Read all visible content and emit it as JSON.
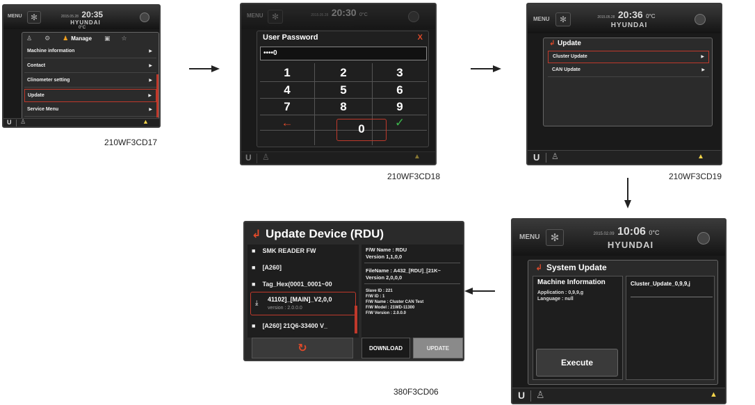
{
  "common": {
    "menu": "MENU",
    "brand": "HYUNDAI",
    "unit_label": "U"
  },
  "s1": {
    "date": "2015.05.28",
    "time": "20:35",
    "temp": "0°C",
    "manage": "Manage",
    "items": [
      "Machine information",
      "Contact",
      "Clinometer setting",
      "Update",
      "Service Menu"
    ],
    "caption": "210WF3CD17"
  },
  "s2": {
    "date": "2015.05.28",
    "time": "20:30",
    "temp": "0°C",
    "title": "User Password",
    "close": "X",
    "value": "••••0",
    "keys": [
      "1",
      "2",
      "3",
      "4",
      "5",
      "6",
      "7",
      "8",
      "9"
    ],
    "zero": "0",
    "back": "←",
    "ok": "✓",
    "caption": "210WF3CD18"
  },
  "s3": {
    "date": "2015.05.28",
    "time": "20:36",
    "temp": "0°C",
    "title": "Update",
    "items": [
      "Cluster Update",
      "CAN Update"
    ],
    "caption": "210WF3CD19"
  },
  "s4": {
    "date": "2015.02.09",
    "time": "10:06",
    "temp": "0°C",
    "title": "System Update",
    "machine_info": "Machine Information",
    "application": "Application : 0,9,9,g",
    "language": "Language : null",
    "file": "Cluster_Update_0,9,9,j",
    "execute": "Execute"
  },
  "s5": {
    "title": "Update Device (RDU)",
    "list": [
      "SMK READER FW",
      "[A260]",
      "Tag_Hex(0001_0001~00",
      "41102]_[MAIN]_V2,0,0",
      "[A260] 21Q6-33400 V_"
    ],
    "sel_version": "version : 2.0.0.0",
    "fw_name": "F/W Name : RDU",
    "fw_version": "Version 1,1,0,0",
    "file_name": "FileName : A432_[RDU]_[21K~",
    "file_version": "Version 2,0,0,0",
    "slave_id": "Slave ID : 221",
    "fw_id": "F/W ID : 1",
    "fw_name2": "F/W Name : Cluster CAN Test",
    "fw_model": "F/W Model : 21WD-11300",
    "fw_version2": "F/W Version : 2.0.0.0",
    "download": "DOWNLOAD",
    "update": "UPDATE",
    "caption": "380F3CD06"
  }
}
